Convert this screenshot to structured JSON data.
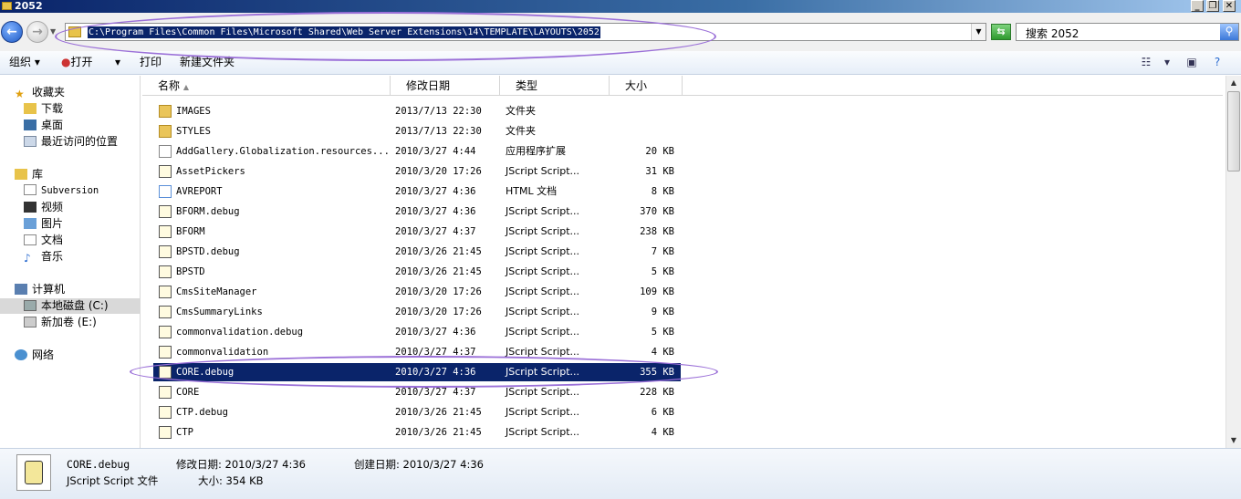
{
  "window": {
    "title": "2052"
  },
  "address": {
    "path": "C:\\Program Files\\Common Files\\Microsoft Shared\\Web Server Extensions\\14\\TEMPLATE\\LAYOUTS\\2052",
    "search_text": "搜索 2052"
  },
  "toolbar": {
    "organize": "组织",
    "open": "打开",
    "print": "打印",
    "new_folder": "新建文件夹"
  },
  "nav": {
    "favorites": "收藏夹",
    "downloads": "下载",
    "desktop": "桌面",
    "recent": "最近访问的位置",
    "libraries": "库",
    "subversion": "Subversion",
    "videos": "视频",
    "pictures": "图片",
    "documents": "文档",
    "music": "音乐",
    "computer": "计算机",
    "local_disk": "本地磁盘 (C:)",
    "new_volume": "新加卷 (E:)",
    "network": "网络"
  },
  "columns": {
    "name": "名称",
    "date": "修改日期",
    "type": "类型",
    "size": "大小"
  },
  "files": [
    {
      "name": "IMAGES",
      "date": "2013/7/13 22:30",
      "type": "文件夹",
      "size": "",
      "icon": "folder-icon"
    },
    {
      "name": "STYLES",
      "date": "2013/7/13 22:30",
      "type": "文件夹",
      "size": "",
      "icon": "folder-icon"
    },
    {
      "name": "AddGallery.Globalization.resources...",
      "date": "2010/3/27 4:44",
      "type": "应用程序扩展",
      "size": "20 KB",
      "icon": "dll-icon"
    },
    {
      "name": "AssetPickers",
      "date": "2010/3/20 17:26",
      "type": "JScript Script...",
      "size": "31 KB",
      "icon": "jscript-icon"
    },
    {
      "name": "AVREPORT",
      "date": "2010/3/27 4:36",
      "type": "HTML 文档",
      "size": "8 KB",
      "icon": "html-icon"
    },
    {
      "name": "BFORM.debug",
      "date": "2010/3/27 4:36",
      "type": "JScript Script...",
      "size": "370 KB",
      "icon": "jscript-icon"
    },
    {
      "name": "BFORM",
      "date": "2010/3/27 4:37",
      "type": "JScript Script...",
      "size": "238 KB",
      "icon": "jscript-icon"
    },
    {
      "name": "BPSTD.debug",
      "date": "2010/3/26 21:45",
      "type": "JScript Script...",
      "size": "7 KB",
      "icon": "jscript-icon"
    },
    {
      "name": "BPSTD",
      "date": "2010/3/26 21:45",
      "type": "JScript Script...",
      "size": "5 KB",
      "icon": "jscript-icon"
    },
    {
      "name": "CmsSiteManager",
      "date": "2010/3/20 17:26",
      "type": "JScript Script...",
      "size": "109 KB",
      "icon": "jscript-icon"
    },
    {
      "name": "CmsSummaryLinks",
      "date": "2010/3/20 17:26",
      "type": "JScript Script...",
      "size": "9 KB",
      "icon": "jscript-icon"
    },
    {
      "name": "commonvalidation.debug",
      "date": "2010/3/27 4:36",
      "type": "JScript Script...",
      "size": "5 KB",
      "icon": "jscript-icon"
    },
    {
      "name": "commonvalidation",
      "date": "2010/3/27 4:37",
      "type": "JScript Script...",
      "size": "4 KB",
      "icon": "jscript-icon"
    },
    {
      "name": "CORE.debug",
      "date": "2010/3/27 4:36",
      "type": "JScript Script...",
      "size": "355 KB",
      "icon": "jscript-icon",
      "selected": true
    },
    {
      "name": "CORE",
      "date": "2010/3/27 4:37",
      "type": "JScript Script...",
      "size": "228 KB",
      "icon": "jscript-icon"
    },
    {
      "name": "CTP.debug",
      "date": "2010/3/26 21:45",
      "type": "JScript Script...",
      "size": "6 KB",
      "icon": "jscript-icon"
    },
    {
      "name": "CTP",
      "date": "2010/3/26 21:45",
      "type": "JScript Script...",
      "size": "4 KB",
      "icon": "jscript-icon"
    }
  ],
  "details": {
    "name": "CORE.debug",
    "type": "JScript Script 文件",
    "modified": "修改日期: 2010/3/27 4:36",
    "created": "创建日期: 2010/3/27 4:36",
    "size": "大小: 354 KB"
  },
  "colors": {
    "selection": "#0a246a",
    "annotation": "#9b70d8"
  }
}
